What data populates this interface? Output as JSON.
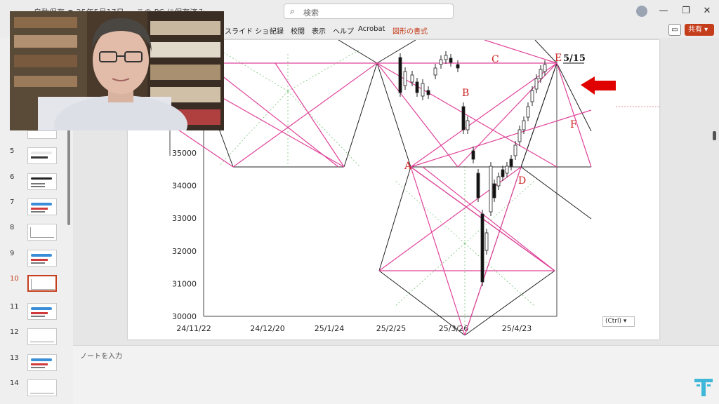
{
  "titlebar": {
    "title": "自動保存 ● 25年5月17日 ... この PC に保存済み",
    "search_placeholder": "検索",
    "minimize": "—",
    "maximize": "❐",
    "close": "✕"
  },
  "ribbon": {
    "tabs": [
      "スライド ショー",
      "記録",
      "校閲",
      "表示",
      "ヘルプ",
      "Acrobat",
      "図形の書式"
    ],
    "comment_icon": "comment-icon",
    "share_label": "共有 ▾"
  },
  "thumbnails": [
    {
      "num": "5",
      "kind": "title"
    },
    {
      "num": "6",
      "kind": "text"
    },
    {
      "num": "7",
      "kind": "title"
    },
    {
      "num": "8",
      "kind": "chart"
    },
    {
      "num": "9",
      "kind": "title"
    },
    {
      "num": "10",
      "kind": "chart",
      "active": true
    },
    {
      "num": "11",
      "kind": "title"
    },
    {
      "num": "12",
      "kind": "chart"
    },
    {
      "num": "13",
      "kind": "title"
    },
    {
      "num": "14",
      "kind": "chart"
    }
  ],
  "notes": {
    "placeholder": "ノートを入力"
  },
  "paste_options": {
    "label": "(Ctrl) ▾"
  },
  "chart_data": {
    "type": "candlestick",
    "y_ticks": [
      30000,
      31000,
      32000,
      33000,
      34000,
      35000
    ],
    "x_ticks": [
      "24/11/22",
      "24/12/20",
      "25/1/24",
      "25/2/25",
      "25/3/26",
      "25/4/23"
    ],
    "points": [
      "A",
      "B",
      "C",
      "D",
      "E",
      "F"
    ],
    "annotation": "5/15",
    "colors": {
      "pattern_lines": "#e0439a",
      "black_lines": "#222222",
      "arrow": "#e00000",
      "point_labels": "#cc2222"
    }
  }
}
